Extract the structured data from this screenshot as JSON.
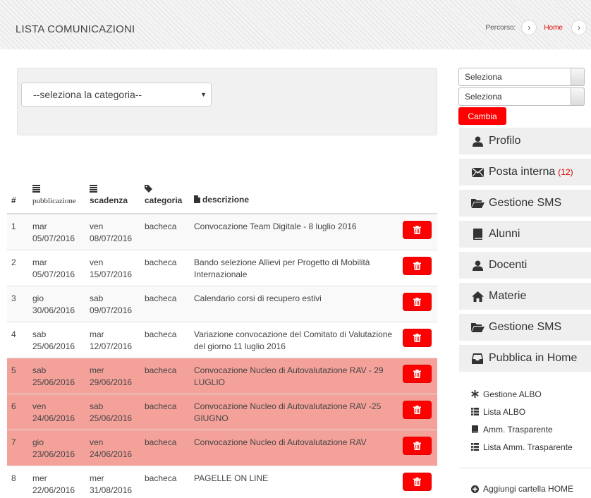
{
  "header": {
    "title": "LISTA COMUNICAZIONI",
    "breadcrumb_label": "Percorso:",
    "breadcrumb_home": "Home"
  },
  "filter": {
    "category_placeholder": "--seleziona la categoria--"
  },
  "table": {
    "columns": {
      "num": "#",
      "pubblicazione": "pubblicazione",
      "scadenza": "scadenza",
      "categoria": "categoria",
      "descrizione": "descrizione"
    },
    "rows": [
      {
        "num": "1",
        "pub_day": "mar",
        "pub_date": "05/07/2016",
        "scad_day": "ven",
        "scad_date": "08/07/2016",
        "categoria": "bacheca",
        "descrizione": "Convocazione Team Digitale - 8 luglio 2016",
        "expired": false
      },
      {
        "num": "2",
        "pub_day": "mar",
        "pub_date": "05/07/2016",
        "scad_day": "ven",
        "scad_date": "15/07/2016",
        "categoria": "bacheca",
        "descrizione": "Bando selezione Allievi per Progetto di Mobilità Internazionale",
        "expired": false
      },
      {
        "num": "3",
        "pub_day": "gio",
        "pub_date": "30/06/2016",
        "scad_day": "sab",
        "scad_date": "09/07/2016",
        "categoria": "bacheca",
        "descrizione": "Calendario corsi di recupero estivi",
        "expired": false
      },
      {
        "num": "4",
        "pub_day": "sab",
        "pub_date": "25/06/2016",
        "scad_day": "mar",
        "scad_date": "12/07/2016",
        "categoria": "bacheca",
        "descrizione": "Variazione convocazione del Comitato di Valutazione del giorno 11 luglio 2016",
        "expired": false
      },
      {
        "num": "5",
        "pub_day": "sab",
        "pub_date": "25/06/2016",
        "scad_day": "mer",
        "scad_date": "29/06/2016",
        "categoria": "bacheca",
        "descrizione": "Convocazione Nucleo di Autovalutazione RAV - 29 LUGLIO",
        "expired": true
      },
      {
        "num": "6",
        "pub_day": "ven",
        "pub_date": "24/06/2016",
        "scad_day": "sab",
        "scad_date": "25/06/2016",
        "categoria": "bacheca",
        "descrizione": "Convocazione Nucleo di Autovalutazione RAV -25 GIUGNO",
        "expired": true
      },
      {
        "num": "7",
        "pub_day": "gio",
        "pub_date": "23/06/2016",
        "scad_day": "ven",
        "scad_date": "24/06/2016",
        "categoria": "bacheca",
        "descrizione": "Convocazione Nucleo di Autovalutazione RAV",
        "expired": true
      },
      {
        "num": "8",
        "pub_day": "mer",
        "pub_date": "22/06/2016",
        "scad_day": "mer",
        "scad_date": "31/08/2016",
        "categoria": "bacheca",
        "descrizione": "PAGELLE ON LINE",
        "expired": false
      }
    ]
  },
  "sidebar": {
    "select1": "Seleziona",
    "select2": "Seleziona",
    "cambia_label": "Cambia",
    "menu": [
      {
        "label": "Profilo",
        "icon": "user-icon"
      },
      {
        "label": "Posta interna",
        "count": "(12)",
        "icon": "envelope-icon"
      },
      {
        "label": "Gestione SMS",
        "icon": "folder-open-icon"
      },
      {
        "label": "Alunni",
        "icon": "book-icon"
      },
      {
        "label": "Docenti",
        "icon": "user-icon"
      },
      {
        "label": "Materie",
        "icon": "home-icon"
      },
      {
        "label": "Gestione SMS",
        "icon": "folder-open-icon"
      },
      {
        "label": "Pubblica in Home",
        "icon": "inbox-icon"
      }
    ],
    "sublinks": [
      {
        "label": "Gestione ALBO",
        "icon": "asterisk-icon"
      },
      {
        "label": "Lista ALBO",
        "icon": "list-icon"
      },
      {
        "label": "Amm. Trasparente",
        "icon": "book-icon"
      },
      {
        "label": "Lista Amm. Trasparente",
        "icon": "list-icon"
      }
    ],
    "add_link": "Aggiungi cartella HOME"
  },
  "colors": {
    "accent_red": "#ff0000",
    "expired_row": "#f4a19a",
    "menu_bg": "#efefef"
  }
}
